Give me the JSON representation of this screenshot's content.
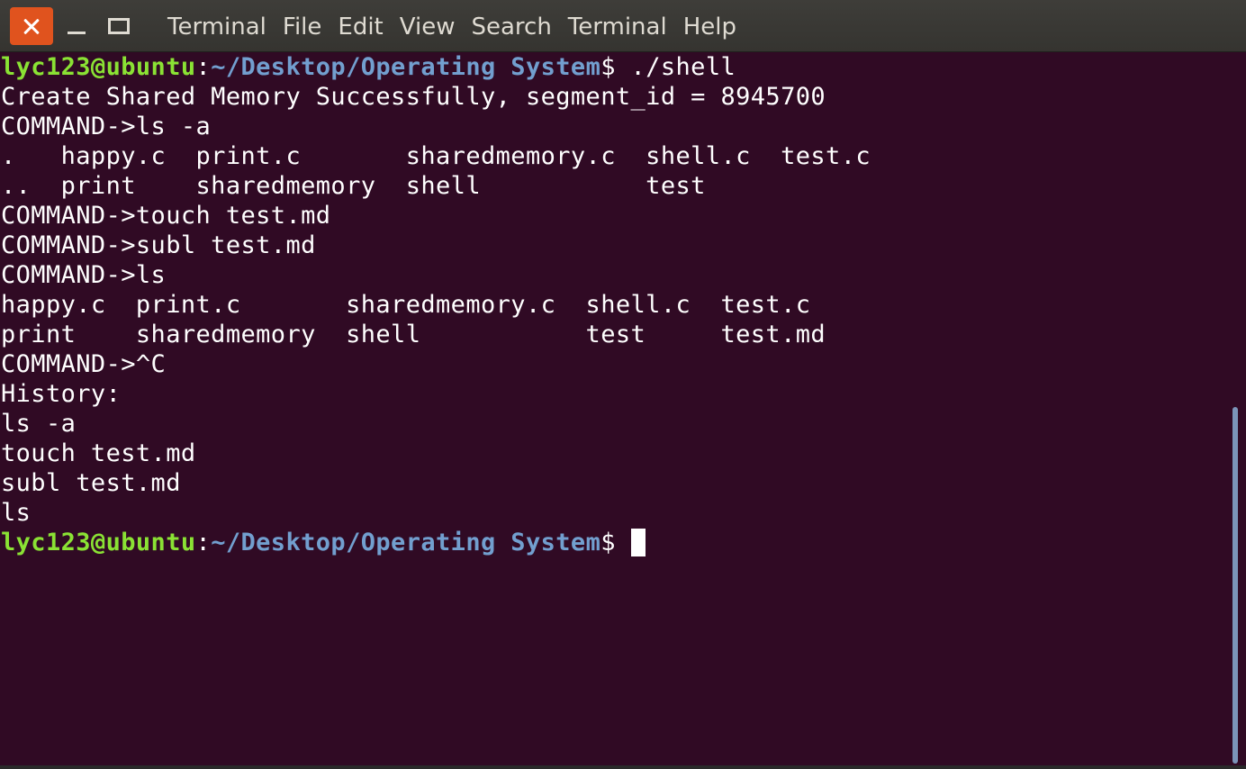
{
  "window": {
    "buttons": {
      "close": "close-icon",
      "minimize": "minimize-icon",
      "maximize": "maximize-icon"
    },
    "menu": [
      "Terminal",
      "File",
      "Edit",
      "View",
      "Search",
      "Terminal",
      "Help"
    ]
  },
  "colors": {
    "background": "#300a24",
    "prompt_user": "#8ae234",
    "prompt_path": "#729fcf",
    "close_button": "#e0531e",
    "scrollbar": "#7b94b8"
  },
  "terminal": {
    "prompt": {
      "user_host": "lyc123@ubuntu",
      "colon": ":",
      "path": "~/Desktop/Operating System",
      "dollar": "$ "
    },
    "first_command": "./shell",
    "output": [
      "Create Shared Memory Successfully, segment_id = 8945700",
      "COMMAND->ls -a",
      ".   happy.c  print.c       sharedmemory.c  shell.c  test.c",
      "..  print    sharedmemory  shell           test",
      "COMMAND->touch test.md",
      "COMMAND->subl test.md",
      "COMMAND->ls",
      "happy.c  print.c       sharedmemory.c  shell.c  test.c",
      "print    sharedmemory  shell           test     test.md",
      "COMMAND->^C",
      "History:",
      "ls -a",
      "touch test.md",
      "subl test.md",
      "ls"
    ]
  }
}
